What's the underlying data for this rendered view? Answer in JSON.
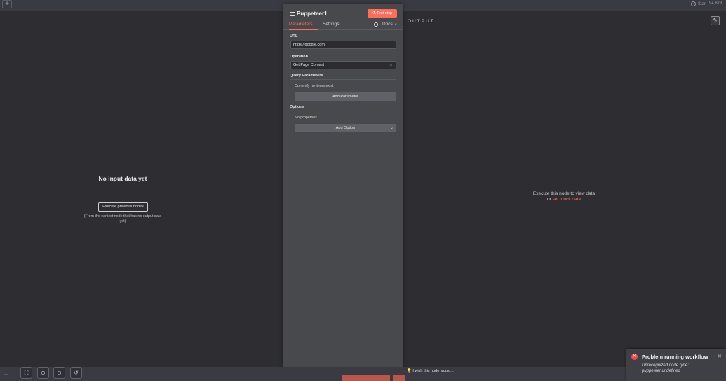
{
  "topbar": {
    "add_icon": "plus-icon",
    "github_label": "Star",
    "github_count": "94,878"
  },
  "input_panel": {
    "title": "No input data yet",
    "execute_button": "Execute previous nodes",
    "note": "(From the earliest node that has no output data yet)"
  },
  "output_panel": {
    "label": "OUTPUT",
    "edit_icon": "pencil-icon",
    "message_line1": "Execute this node to view data",
    "message_or": "or ",
    "mock_link": "set mock data"
  },
  "node": {
    "title": "Puppeteer1",
    "test_button": "Test step",
    "tabs": [
      "Parameters",
      "Settings"
    ],
    "docs_label": "Docs",
    "url_label": "URL",
    "url_value": "https://google.com",
    "operation_label": "Operation",
    "operation_value": "Get Page Content",
    "query_label": "Query Parameters",
    "query_note": "Currently no items exist",
    "add_parameter": "Add Parameter",
    "options_label": "Options",
    "options_note": "No properties",
    "add_option": "Add Option"
  },
  "bottombar": {
    "wish_text": "I wish this node would..."
  },
  "toast": {
    "title": "Problem running workflow",
    "message": "Unrecognized node type: puppeteer.undefined"
  },
  "colors": {
    "accent": "#ff6d5a",
    "error": "#ea4b4b"
  }
}
